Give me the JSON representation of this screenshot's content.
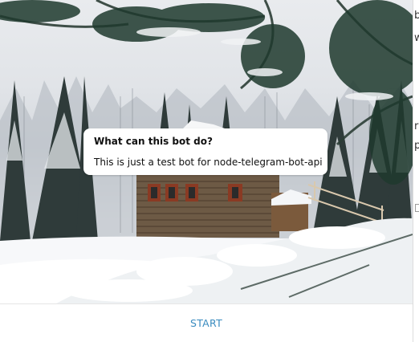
{
  "bot_info": {
    "title": "What can this bot do?",
    "description": "This is just a test bot for node-telegram-bot-api"
  },
  "bottom_bar": {
    "start_label": "START"
  },
  "right_edge": {
    "glyph_1": "b",
    "glyph_2": "w",
    "glyph_3": "r",
    "glyph_4": "p"
  },
  "colors": {
    "accent": "#3a8bbf",
    "background": "#ffffff",
    "bubble": "#ffffff",
    "text": "#111111"
  }
}
